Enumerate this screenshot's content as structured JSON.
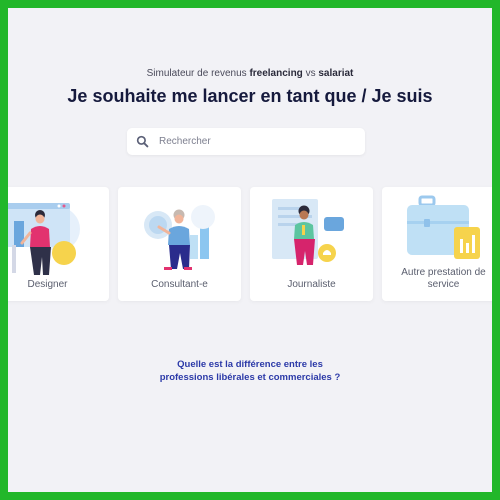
{
  "header": {
    "subtitle_prefix": "Simulateur de revenus",
    "subtitle_bold_1": "freelancing",
    "subtitle_mid": "vs",
    "subtitle_bold_2": "salariat",
    "title": "Je souhaite me lancer en tant que / Je suis"
  },
  "search": {
    "placeholder": "Rechercher",
    "icon": "search-icon"
  },
  "cards": [
    {
      "label": "Designer",
      "icon": "designer-illustration"
    },
    {
      "label": "Consultant-e",
      "icon": "consultant-illustration"
    },
    {
      "label": "Journaliste",
      "icon": "journalist-illustration"
    },
    {
      "label_line1": "Autre prestation de",
      "label_line2": "service",
      "icon": "briefcase-illustration"
    }
  ],
  "footer": {
    "link_line1": "Quelle est la différence entre les",
    "link_line2": "professions libérales et commerciales ?"
  },
  "colors": {
    "border": "#22b72a",
    "background": "#f2f2f6",
    "title": "#161a3d",
    "link": "#2c3aa8",
    "accent_blue": "#bfe0f5",
    "accent_yellow": "#f6d34c",
    "accent_magenta": "#d6246c"
  }
}
